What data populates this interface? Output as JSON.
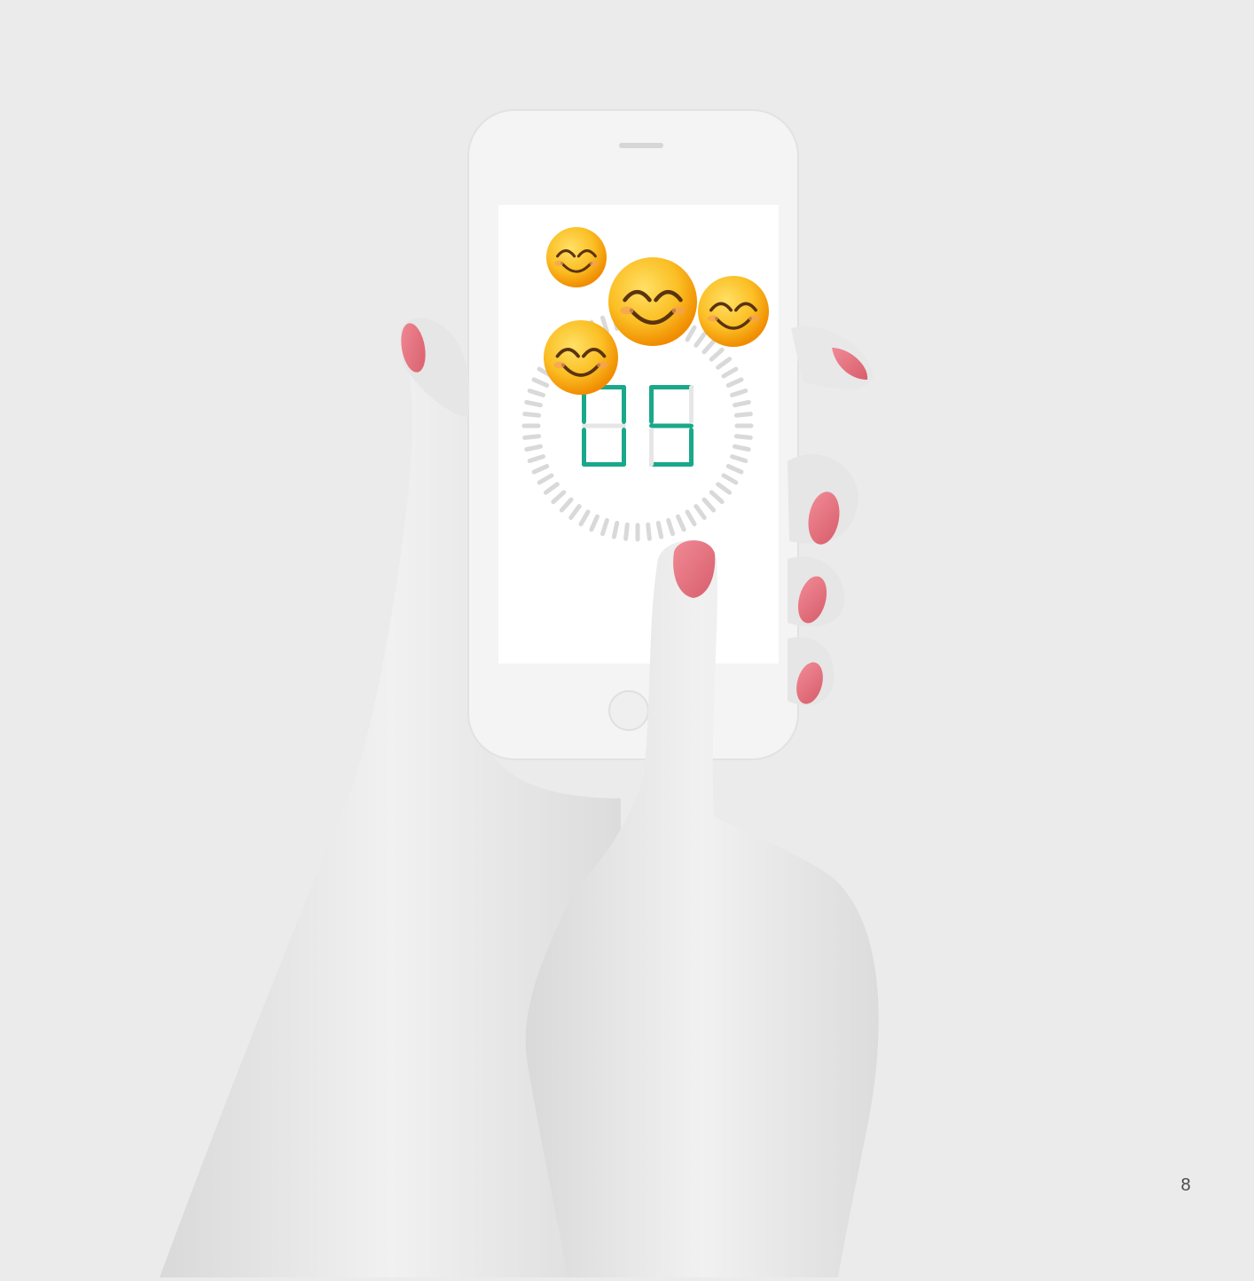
{
  "timer": {
    "digits": [
      "0",
      "5"
    ],
    "progress_fraction": 0.083,
    "tick_count": 60,
    "active_color": "#1aa88a",
    "inactive_color": "#d9d9d9"
  },
  "emoji": {
    "icon": "smiling-face-with-smiling-eyes",
    "glyph": "😊",
    "count": 4
  },
  "colors": {
    "background": "#ebebeb",
    "phone_body": "#f2f2f2",
    "screen": "#ffffff",
    "skin": "#e6e6e6",
    "nail": "#e0707c"
  },
  "page": {
    "number": "8"
  }
}
